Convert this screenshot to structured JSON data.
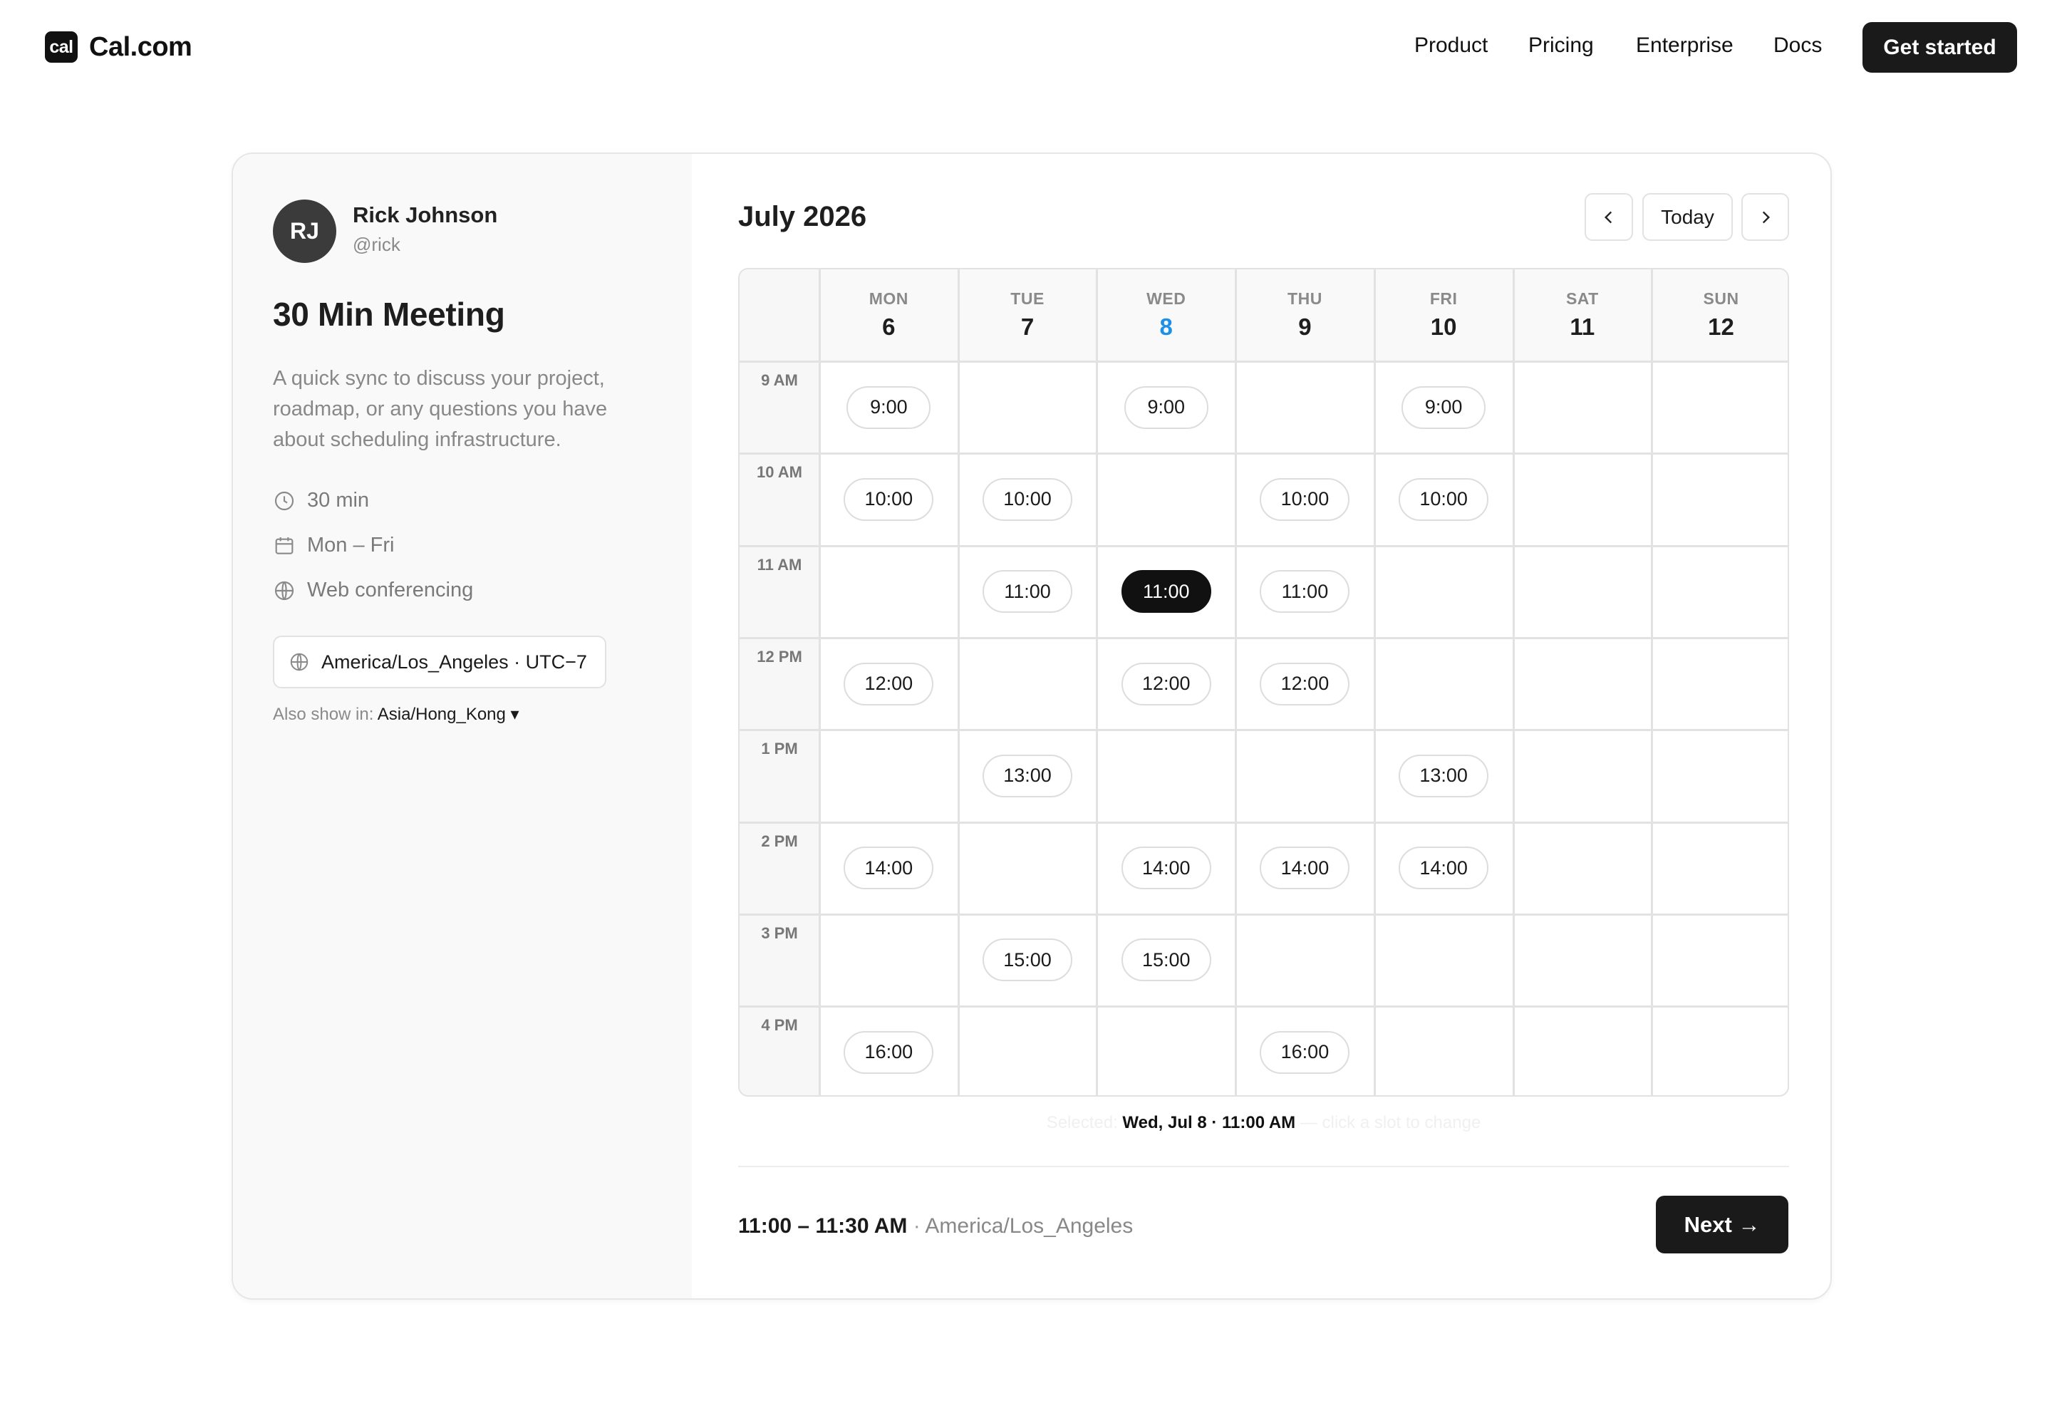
{
  "nav": {
    "brand_mark": "cal",
    "brand_name": "Cal.com",
    "links": [
      "Product",
      "Pricing",
      "Enterprise",
      "Docs"
    ],
    "cta": "Get started"
  },
  "host": {
    "initials": "RJ",
    "name": "Rick Johnson",
    "handle": "@rick"
  },
  "event": {
    "title": "30 Min Meeting",
    "description": "A quick sync to discuss your project, roadmap, or any questions you have about scheduling infrastructure.",
    "duration": "30 min",
    "days": "Mon – Fri",
    "location": "Web conferencing",
    "timezone": "America/Los_Angeles · UTC−7",
    "also_show_label": "Also show in:",
    "also_show_tz": "Asia/Hong_Kong ▾"
  },
  "calendar": {
    "month_title": "July 2026",
    "today_label": "Today",
    "days": [
      {
        "name": "MON",
        "num": "6"
      },
      {
        "name": "TUE",
        "num": "7"
      },
      {
        "name": "WED",
        "num": "8",
        "today": true
      },
      {
        "name": "THU",
        "num": "9"
      },
      {
        "name": "FRI",
        "num": "10"
      },
      {
        "name": "SAT",
        "num": "11"
      },
      {
        "name": "SUN",
        "num": "12"
      }
    ],
    "hours": [
      "9 AM",
      "10 AM",
      "11 AM",
      "12 PM",
      "1 PM",
      "2 PM",
      "3 PM",
      "4 PM"
    ],
    "slots": [
      {
        "day": 0,
        "hour": 0,
        "label": "9:00"
      },
      {
        "day": 2,
        "hour": 0,
        "label": "9:00"
      },
      {
        "day": 4,
        "hour": 0,
        "label": "9:00"
      },
      {
        "day": 0,
        "hour": 1,
        "label": "10:00"
      },
      {
        "day": 1,
        "hour": 1,
        "label": "10:00"
      },
      {
        "day": 3,
        "hour": 1,
        "label": "10:00"
      },
      {
        "day": 4,
        "hour": 1,
        "label": "10:00"
      },
      {
        "day": 1,
        "hour": 2,
        "label": "11:00"
      },
      {
        "day": 2,
        "hour": 2,
        "label": "11:00",
        "selected": true
      },
      {
        "day": 3,
        "hour": 2,
        "label": "11:00"
      },
      {
        "day": 0,
        "hour": 3,
        "label": "12:00"
      },
      {
        "day": 2,
        "hour": 3,
        "label": "12:00"
      },
      {
        "day": 3,
        "hour": 3,
        "label": "12:00"
      },
      {
        "day": 1,
        "hour": 4,
        "label": "13:00"
      },
      {
        "day": 4,
        "hour": 4,
        "label": "13:00"
      },
      {
        "day": 0,
        "hour": 5,
        "label": "14:00"
      },
      {
        "day": 2,
        "hour": 5,
        "label": "14:00"
      },
      {
        "day": 3,
        "hour": 5,
        "label": "14:00"
      },
      {
        "day": 4,
        "hour": 5,
        "label": "14:00"
      },
      {
        "day": 1,
        "hour": 6,
        "label": "15:00"
      },
      {
        "day": 2,
        "hour": 6,
        "label": "15:00"
      },
      {
        "day": 0,
        "hour": 7,
        "label": "16:00"
      },
      {
        "day": 3,
        "hour": 7,
        "label": "16:00"
      }
    ]
  },
  "selection": {
    "prefix": "Selected: ",
    "value": "Wed, Jul 8 · 11:00 AM",
    "suffix": " — click a slot to change"
  },
  "summary": {
    "time": "11:00 – 11:30 AM",
    "separator": " · ",
    "timezone": "America/Los_Angeles",
    "next_label": "Next →"
  },
  "colors": {
    "accent_today": "#1e90e6",
    "dark": "#111111",
    "panel": "#f9f9f9"
  }
}
